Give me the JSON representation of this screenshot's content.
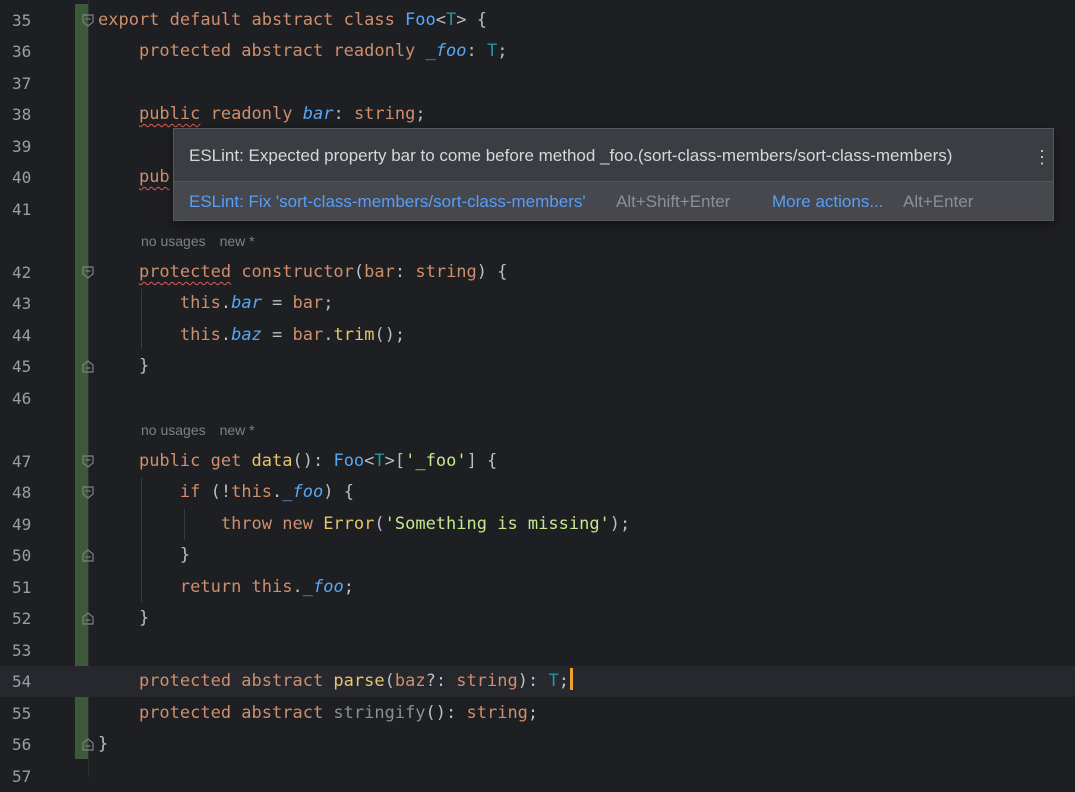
{
  "editor": {
    "lines": [
      {
        "n": "35",
        "code": [
          [
            "k",
            "export default abstract class "
          ],
          [
            "t",
            "Foo"
          ],
          [
            "p",
            "<"
          ],
          [
            "tp",
            "T"
          ],
          [
            "p",
            "> {"
          ]
        ]
      },
      {
        "n": "36",
        "code": [
          [
            "p",
            "    "
          ],
          [
            "k",
            "protected abstract readonly "
          ],
          [
            "f",
            "_foo"
          ],
          [
            "p",
            ": "
          ],
          [
            "tp",
            "T"
          ],
          [
            "p",
            ";"
          ]
        ]
      },
      {
        "n": "37",
        "code": []
      },
      {
        "n": "38",
        "code": [
          [
            "p",
            "    "
          ],
          [
            "ks",
            "public"
          ],
          [
            "k",
            " readonly "
          ],
          [
            "f",
            "bar"
          ],
          [
            "p",
            ": "
          ],
          [
            "k",
            "string"
          ],
          [
            "p",
            ";"
          ]
        ]
      },
      {
        "n": "39",
        "code": []
      },
      {
        "n": "40",
        "code": [
          [
            "p",
            "    "
          ],
          [
            "ks",
            "pub"
          ]
        ]
      },
      {
        "n": "41",
        "code": []
      },
      {
        "n": "42",
        "code": [
          [
            "p",
            "    "
          ],
          [
            "ks",
            "protected"
          ],
          [
            "k",
            " constructor"
          ],
          [
            "p",
            "("
          ],
          [
            "k",
            "bar"
          ],
          [
            "p",
            ": "
          ],
          [
            "k",
            "string"
          ],
          [
            "p",
            ") {"
          ]
        ]
      },
      {
        "n": "43",
        "code": [
          [
            "p",
            "        "
          ],
          [
            "k",
            "this"
          ],
          [
            "p",
            "."
          ],
          [
            "f",
            "bar"
          ],
          [
            "p",
            " = "
          ],
          [
            "k",
            "bar"
          ],
          [
            "p",
            ";"
          ]
        ]
      },
      {
        "n": "44",
        "code": [
          [
            "p",
            "        "
          ],
          [
            "k",
            "this"
          ],
          [
            "p",
            "."
          ],
          [
            "f",
            "baz"
          ],
          [
            "p",
            " = "
          ],
          [
            "k",
            "bar"
          ],
          [
            "p",
            "."
          ],
          [
            "fn",
            "trim"
          ],
          [
            "p",
            "();"
          ]
        ]
      },
      {
        "n": "45",
        "code": [
          [
            "p",
            "    }"
          ]
        ]
      },
      {
        "n": "46",
        "code": []
      },
      {
        "n": "47",
        "code": [
          [
            "p",
            "    "
          ],
          [
            "k",
            "public get "
          ],
          [
            "fn",
            "data"
          ],
          [
            "p",
            "(): "
          ],
          [
            "t",
            "Foo"
          ],
          [
            "p",
            "<"
          ],
          [
            "tp",
            "T"
          ],
          [
            "p",
            ">["
          ],
          [
            "s",
            "'_foo'"
          ],
          [
            "p",
            "] {"
          ]
        ]
      },
      {
        "n": "48",
        "code": [
          [
            "p",
            "        "
          ],
          [
            "k",
            "if "
          ],
          [
            "p",
            "(!"
          ],
          [
            "k",
            "this"
          ],
          [
            "p",
            "."
          ],
          [
            "f",
            "_foo"
          ],
          [
            "p",
            ") {"
          ]
        ]
      },
      {
        "n": "49",
        "code": [
          [
            "p",
            "            "
          ],
          [
            "k",
            "throw new "
          ],
          [
            "fn",
            "Error"
          ],
          [
            "p",
            "("
          ],
          [
            "s",
            "'Something is missing'"
          ],
          [
            "p",
            ");"
          ]
        ]
      },
      {
        "n": "50",
        "code": [
          [
            "p",
            "        }"
          ]
        ]
      },
      {
        "n": "51",
        "code": [
          [
            "p",
            "        "
          ],
          [
            "k",
            "return this"
          ],
          [
            "p",
            "."
          ],
          [
            "f",
            "_foo"
          ],
          [
            "p",
            ";"
          ]
        ]
      },
      {
        "n": "52",
        "code": [
          [
            "p",
            "    }"
          ]
        ]
      },
      {
        "n": "53",
        "code": []
      },
      {
        "n": "54",
        "code": [
          [
            "p",
            "    "
          ],
          [
            "k",
            "protected abstract "
          ],
          [
            "fn",
            "parse"
          ],
          [
            "p",
            "("
          ],
          [
            "k",
            "baz"
          ],
          [
            "p",
            "?: "
          ],
          [
            "k",
            "string"
          ],
          [
            "p",
            "): "
          ],
          [
            "tp",
            "T"
          ],
          [
            "p",
            ";"
          ]
        ]
      },
      {
        "n": "55",
        "code": [
          [
            "p",
            "    "
          ],
          [
            "k",
            "protected abstract "
          ],
          [
            "muted",
            "stringify"
          ],
          [
            "p",
            "(): "
          ],
          [
            "k",
            "string"
          ],
          [
            "p",
            ";"
          ]
        ]
      },
      {
        "n": "56",
        "code": [
          [
            "p",
            "}"
          ]
        ]
      },
      {
        "n": "57",
        "code": []
      }
    ],
    "hints": [
      {
        "usages": "no usages",
        "author": "new *"
      },
      {
        "usages": "no usages",
        "author": "new *"
      }
    ]
  },
  "popup": {
    "message": "ESLint: Expected property bar to come before method _foo.(sort-class-members/sort-class-members)",
    "kebab_icon": "⋮",
    "fix_action": "ESLint: Fix 'sort-class-members/sort-class-members'",
    "fix_shortcut": "Alt+Shift+Enter",
    "more_action": "More actions...",
    "more_shortcut": "Alt+Enter"
  },
  "colors": {
    "background": "#1e1f22",
    "keyword": "#cf8e6d",
    "type": "#56a8f5",
    "string": "#c3e88d",
    "error_underline": "#e05a5a",
    "link": "#589df6"
  }
}
